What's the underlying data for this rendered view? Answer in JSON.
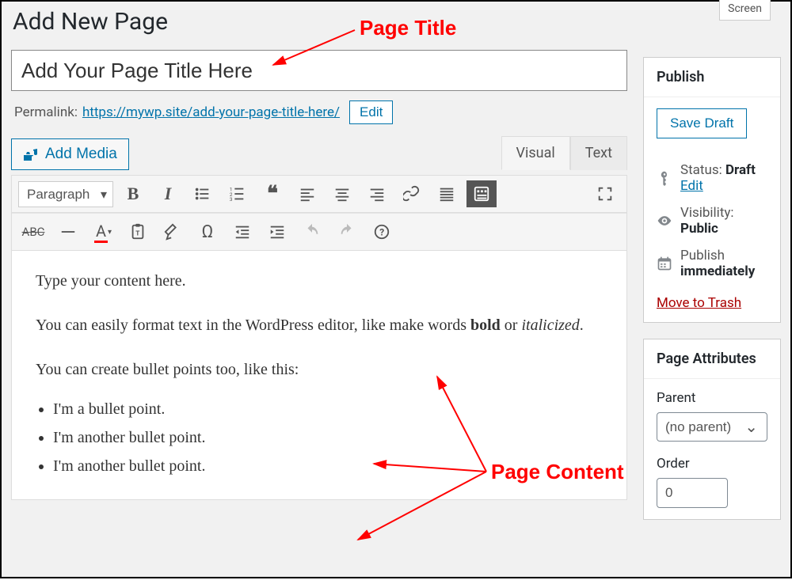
{
  "screen_tab": "Screen",
  "heading": "Add New Page",
  "title_value": "Add Your Page Title Here",
  "permalink": {
    "label": "Permalink:",
    "base": "https://mywp.site/",
    "slug": "add-your-page-title-here/",
    "edit": "Edit"
  },
  "add_media": "Add Media",
  "tabs": {
    "visual": "Visual",
    "text": "Text"
  },
  "format_select": "Paragraph",
  "content": {
    "p1": "Type your content here.",
    "p2_a": "You can easily format text in the WordPress editor, like make words ",
    "p2_bold": "bold",
    "p2_b": " or ",
    "p2_italic": "italicized",
    "p2_c": ".",
    "p3": "You can create bullet points too, like this:",
    "bullets": [
      "I'm a bullet point.",
      "I'm another bullet point.",
      "I'm another bullet point."
    ]
  },
  "publish": {
    "title": "Publish",
    "save_draft": "Save Draft",
    "status_label": "Status:",
    "status_value": "Draft",
    "status_edit": "Edit",
    "visibility_label": "Visibility:",
    "visibility_value": "Public",
    "schedule_label": "Publish",
    "schedule_value": "immediately",
    "trash": "Move to Trash"
  },
  "attributes": {
    "title": "Page Attributes",
    "parent_label": "Parent",
    "parent_value": "(no parent)",
    "order_label": "Order",
    "order_value": "0"
  },
  "annotations": {
    "page_title": "Page Title",
    "page_content": "Page Content"
  }
}
